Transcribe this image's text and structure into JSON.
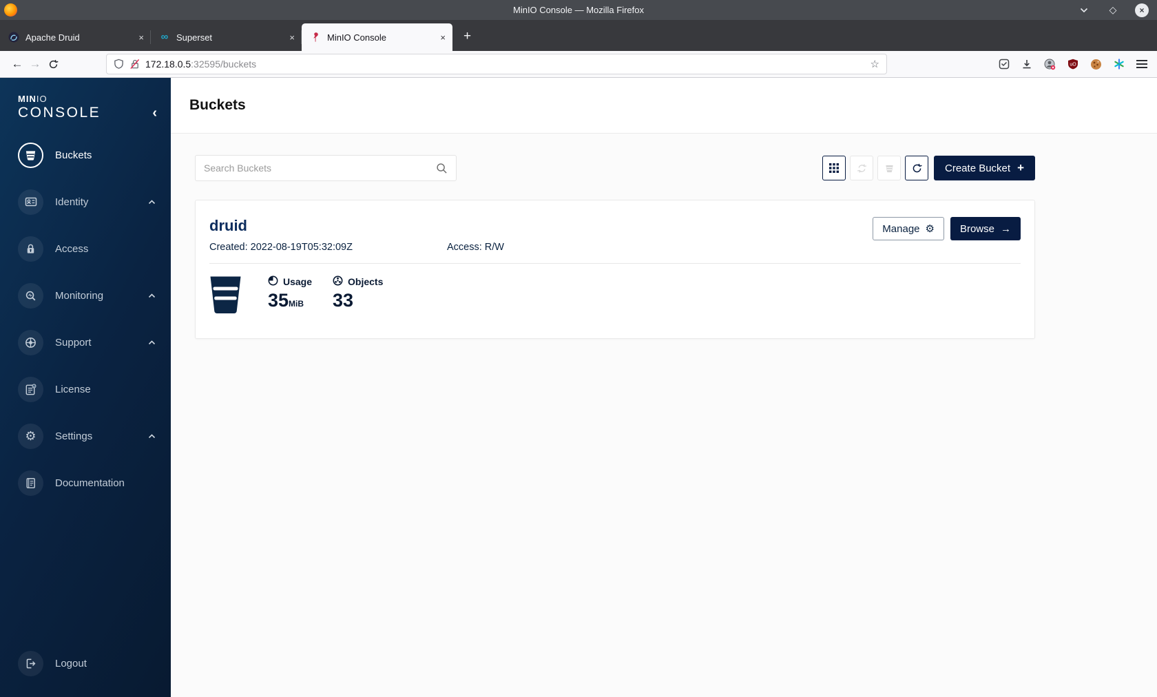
{
  "window": {
    "title": "MinIO Console — Mozilla Firefox"
  },
  "browser": {
    "tabs": [
      {
        "label": "Apache Druid",
        "active": false
      },
      {
        "label": "Superset",
        "active": false
      },
      {
        "label": "MinIO Console",
        "active": true
      }
    ],
    "url": {
      "host": "172.18.0.5",
      "rest": ":32595/buckets"
    }
  },
  "sidebar": {
    "logo_min": "MIN",
    "logo_io": "IO",
    "logo_line2": "CONSOLE",
    "items": [
      {
        "label": "Buckets",
        "icon": "bucket-icon",
        "selected": true
      },
      {
        "label": "Identity",
        "icon": "identity-card-icon",
        "caret": true
      },
      {
        "label": "Access",
        "icon": "lock-icon"
      },
      {
        "label": "Monitoring",
        "icon": "magnifier-icon",
        "caret": true
      },
      {
        "label": "Support",
        "icon": "lifebuoy-icon",
        "caret": true
      },
      {
        "label": "License",
        "icon": "license-document-icon"
      },
      {
        "label": "Settings",
        "icon": "gear-icon",
        "caret": true
      },
      {
        "label": "Documentation",
        "icon": "book-icon"
      }
    ],
    "logout_label": "Logout"
  },
  "page": {
    "title": "Buckets",
    "search_placeholder": "Search Buckets",
    "create_button_label": "Create Bucket",
    "bucket": {
      "name": "druid",
      "created_label": "Created: 2022-08-19T05:32:09Z",
      "access_label": "Access: R/W",
      "manage_label": "Manage",
      "browse_label": "Browse",
      "usage_label": "Usage",
      "usage_value": "35",
      "usage_unit": "MiB",
      "objects_label": "Objects",
      "objects_value": "33"
    }
  },
  "icons": {
    "maximize": "◇",
    "close": "×",
    "close_tab": "×",
    "new_tab": "+",
    "back": "←",
    "forward": "→",
    "star": "☆",
    "superset_infinity": "∞",
    "collapse_chevron": "‹",
    "gear": "⚙",
    "arrow_right": "→",
    "plus": "+",
    "ublock_label": "uO"
  },
  "colors": {
    "navy": "#081c42",
    "sidebar_gradient_start": "#0d3459",
    "sidebar_gradient_end": "#081a31",
    "minio_red": "#c72c49",
    "titlebar": "#474a4f",
    "content_bg": "#fbfbfb"
  }
}
